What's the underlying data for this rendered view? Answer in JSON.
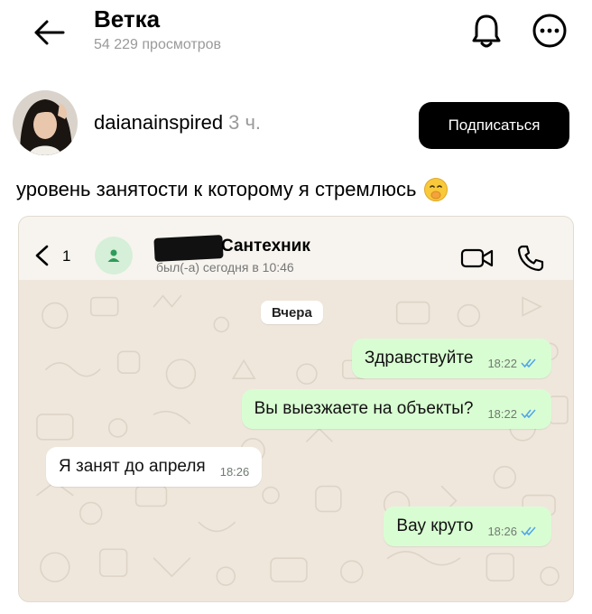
{
  "header": {
    "title": "Ветка",
    "subtitle": "54 229 просмотров"
  },
  "post": {
    "username": "daianainspired",
    "time": "3 ч.",
    "follow_label": "Подписаться",
    "text": "уровень занятости к которому я стремлюсь"
  },
  "chat": {
    "back_count": "1",
    "contact_name": "Сантехник",
    "status": "был(-а) сегодня в 10:46",
    "date_label": "Вчера",
    "messages": [
      {
        "text": "Здравствуйте",
        "time": "18:22",
        "direction": "out"
      },
      {
        "text": "Вы выезжаете на объекты?",
        "time": "18:22",
        "direction": "out"
      },
      {
        "text": "Я занят до апреля",
        "time": "18:26",
        "direction": "in"
      },
      {
        "text": "Вау круто",
        "time": "18:26",
        "direction": "out"
      }
    ]
  },
  "colors": {
    "follow_bg": "#000000",
    "outgoing_bubble": "#d9fdd3",
    "incoming_bubble": "#ffffff",
    "read_ticks": "#53a6e8",
    "chat_bg": "#efe7dc"
  }
}
